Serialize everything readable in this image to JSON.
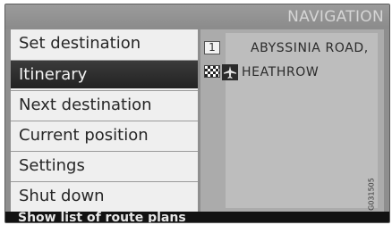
{
  "header": {
    "title": "NAVIGATION"
  },
  "menu": {
    "items": [
      {
        "label": "Set destination",
        "selected": false
      },
      {
        "label": "Itinerary",
        "selected": true
      },
      {
        "label": "Next destination",
        "selected": false
      },
      {
        "label": "Current position",
        "selected": false
      },
      {
        "label": "Settings",
        "selected": false
      },
      {
        "label": "Shut down",
        "selected": false
      }
    ]
  },
  "route": {
    "stops": [
      {
        "badge": "1",
        "name": "ABYSSINIA ROAD,",
        "icon": "waypoint-number-icon"
      },
      {
        "name": "HEATHROW",
        "icon": "checkered-flag-icon",
        "poi_icon": "airplane-icon"
      }
    ]
  },
  "status": {
    "text": "Show list of route plans"
  },
  "watermark": {
    "text": "G031505"
  }
}
